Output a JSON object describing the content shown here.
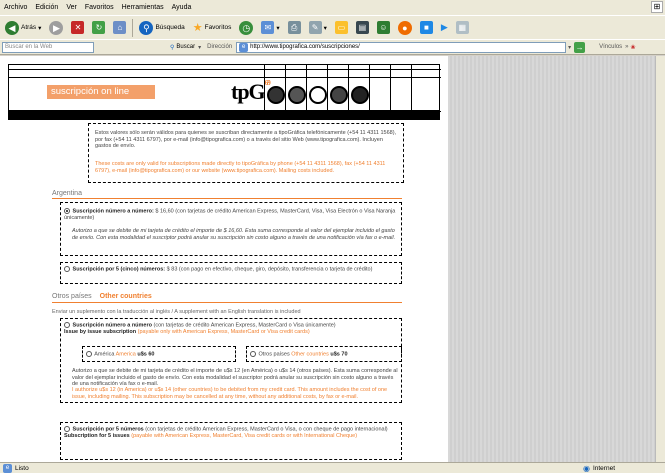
{
  "menu": [
    "Archivo",
    "Edición",
    "Ver",
    "Favoritos",
    "Herramientas",
    "Ayuda"
  ],
  "toolbar": {
    "back_label": "Atrás",
    "search_label": "Búsqueda",
    "favorites_label": "Favoritos"
  },
  "addressbar": {
    "search_web_placeholder": "Buscar en la Web",
    "buscar_label": "Buscar",
    "address_label": "Dirección",
    "url": "http://www.tipografica.com/suscripciones/",
    "links_label": "Vínculos"
  },
  "header": {
    "subscription_title": "suscripción on line",
    "logo_text": "tpG",
    "logo_sup": "69"
  },
  "intro": {
    "es": "Estos valores sólo serán válidos para quienes se suscriban directamente a tipoGráfica telefónicamente (+54 11 4311 1568), por fax (+54 11 4311 6797), por e-mail (info@tipografica.com) o a través del sitio Web (www.tipografica.com). Incluyen gastos de envío.",
    "en": "These costs are only valid for subscriptions made directly to tipoGráfica by phone (+54 11 4311 1568), fax (+54 11 4311 6797), e-mail (info@tipografica.com) or our website (www.tipografica.com). Mailing costs included."
  },
  "argentina": {
    "label": "Argentina",
    "option1_title": "Suscripción número a número:",
    "option1_text": "$ 16,60 (con tarjetas de crédito American Express, MasterCard, Visa, Visa Electrón o Visa Naranja únicamente)",
    "option1_auth": "Autorizo a que se debite de mi tarjeta de crédito el importe de $ 16,60. Esta suma corresponde al valor del ejemplar incluido el gasto de envío. Con esta modalidad el suscriptor podrá anular su suscripción sin costo alguno a través de una notificación vía fax o e-mail.",
    "option2_title": "Suscripción por 5 (cinco) números:",
    "option2_text": "$ 83 (con pago en efectivo, cheque, giro, depósito, transferencia o tarjeta de crédito)"
  },
  "other": {
    "label_es": "Otros países",
    "label_en": "Other countries",
    "note": "Enviar un suplemento con la traducción al inglés / A supplement with an English translation is included",
    "issue_title": "Suscripción número a número",
    "issue_text_es": "(con tarjetas de crédito American Express, MasterCard o Visa únicamente)",
    "issue_title_en": "Issue by issue subscription",
    "issue_text_en": "(payable only with American Express, MasterCard or Visa credit cards)",
    "america_es": "América",
    "america_en": "America",
    "america_price": "u$s 60",
    "others_es": "Otros países",
    "others_en": "Other countries",
    "others_price": "u$s 70",
    "auth_es": "Autorizo a que se debite de mi tarjeta de crédito el importe de u$s 12 (en América) o u$s 14 (otros países). Esta suma corresponde al valor del ejemplar incluido el gasto de envío. Con esta modalidad el suscriptor podrá anular su suscripción sin costo alguno a través de una notificación vía fax o e-mail.",
    "auth_en": "I authorize u$s 12 (in America) or u$s 14 (other countries) to be debited from my credit card. This amount includes the cost of one issue, including mailing. This subscription may be cancelled at any time, without any additional costs, by fax or e-mail.",
    "five_title": "Suscripción por 5 números",
    "five_text": "(con tarjetas de crédito American Express, MasterCard o Visa, o con cheque de pago internacional)",
    "five_title_en": "Subscription for 5 issues",
    "five_text_en": "(payable with American Express, MasterCard, Visa credit cards or with International Cheque)"
  },
  "status": {
    "left": "Listo",
    "zone": "Internet"
  }
}
